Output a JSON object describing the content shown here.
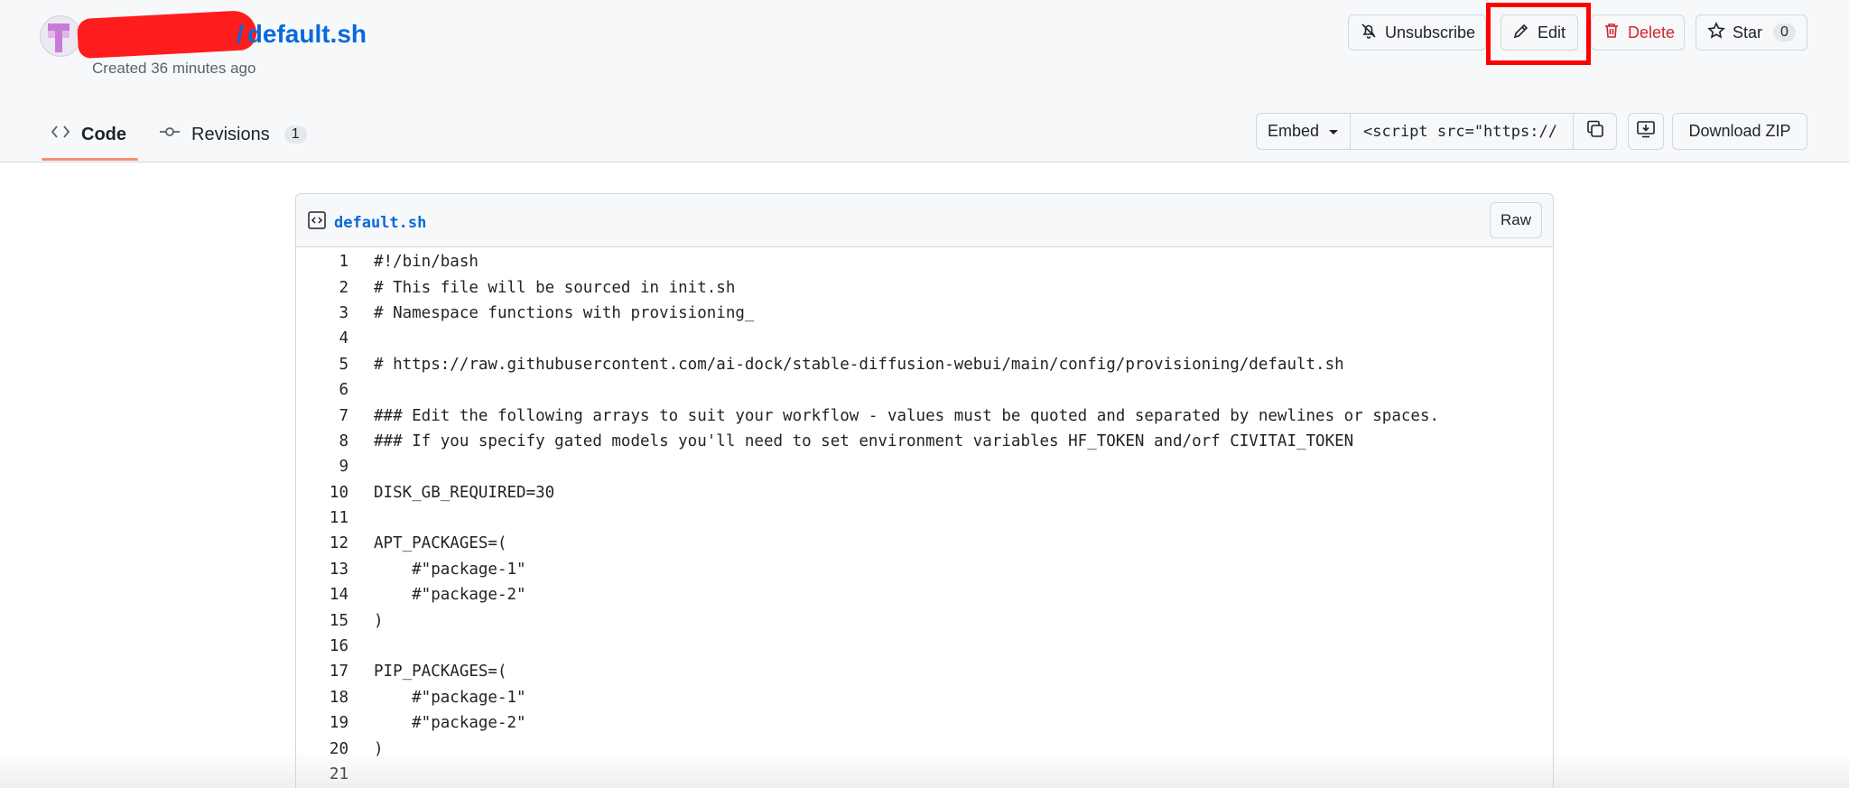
{
  "gist": {
    "title": "default.sh",
    "separator": "/",
    "created": "Created 36 minutes ago"
  },
  "actions": {
    "unsubscribe": "Unsubscribe",
    "edit": "Edit",
    "delete": "Delete",
    "star": "Star",
    "star_count": "0"
  },
  "tabs": {
    "code": "Code",
    "revisions": "Revisions",
    "revisions_count": "1"
  },
  "embed": {
    "select_label": "Embed",
    "input_value": "<script src=\"https://"
  },
  "download": "Download ZIP",
  "file": {
    "name": "default.sh",
    "raw": "Raw",
    "lines": [
      {
        "n": "1",
        "text": "#!/bin/bash"
      },
      {
        "n": "2",
        "text": "# This file will be sourced in init.sh"
      },
      {
        "n": "3",
        "text": "# Namespace functions with provisioning_"
      },
      {
        "n": "4",
        "text": ""
      },
      {
        "n": "5",
        "text": "# https://raw.githubusercontent.com/ai-dock/stable-diffusion-webui/main/config/provisioning/default.sh"
      },
      {
        "n": "6",
        "text": ""
      },
      {
        "n": "7",
        "text": "### Edit the following arrays to suit your workflow - values must be quoted and separated by newlines or spaces."
      },
      {
        "n": "8",
        "text": "### If you specify gated models you'll need to set environment variables HF_TOKEN and/orf CIVITAI_TOKEN"
      },
      {
        "n": "9",
        "text": ""
      },
      {
        "n": "10",
        "text": "DISK_GB_REQUIRED=30"
      },
      {
        "n": "11",
        "text": ""
      },
      {
        "n": "12",
        "text": "APT_PACKAGES=("
      },
      {
        "n": "13",
        "text": "    #\"package-1\""
      },
      {
        "n": "14",
        "text": "    #\"package-2\""
      },
      {
        "n": "15",
        "text": ")"
      },
      {
        "n": "16",
        "text": ""
      },
      {
        "n": "17",
        "text": "PIP_PACKAGES=("
      },
      {
        "n": "18",
        "text": "    #\"package-1\""
      },
      {
        "n": "19",
        "text": "    #\"package-2\""
      },
      {
        "n": "20",
        "text": ")"
      },
      {
        "n": "21",
        "text": ""
      }
    ]
  },
  "colors": {
    "link": "#0969da",
    "danger": "#d1242f",
    "highlight": "#ff0000",
    "redaction": "#ff1c1c",
    "tab_underline": "#fd8c73"
  }
}
